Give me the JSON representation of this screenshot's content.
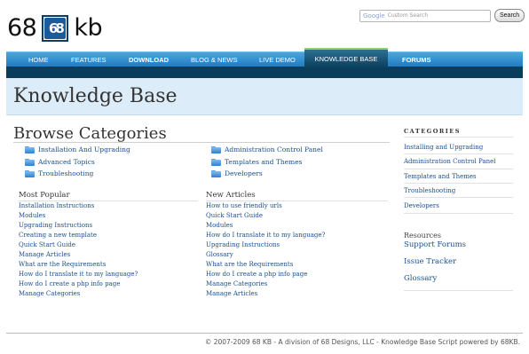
{
  "logo": {
    "left": "68",
    "mark": "68",
    "right": "kb"
  },
  "search": {
    "google": "Google",
    "placeholder": "Custom Search",
    "button": "Search"
  },
  "nav": {
    "items": [
      "HOME",
      "FEATURES",
      "DOWNLOAD",
      "BLOG & NEWS",
      "LIVE DEMO",
      "KNOWLEDGE BASE",
      "FORUMS"
    ],
    "active": "KNOWLEDGE BASE"
  },
  "page_title": "Knowledge Base",
  "browse": {
    "heading": "Browse Categories",
    "categories_left": [
      "Installation And Upgrading",
      "Advanced Topics",
      "Troubleshooting"
    ],
    "categories_right": [
      "Administration Control Panel",
      "Templates and Themes",
      "Developers"
    ]
  },
  "most_popular": {
    "heading": "Most Popular",
    "items": [
      "Installation Instructions",
      "Modules",
      "Upgrading Instructions",
      "Creating a new template",
      "Quick Start Guide",
      "Manage Articles",
      "What are the Requirements",
      "How do I translate it to my language?",
      "How do I create a php info page",
      "Manage Categories"
    ]
  },
  "new_articles": {
    "heading": "New Articles",
    "items": [
      "How to use friendly urls",
      "Quick Start Guide",
      "Modules",
      "How do I translate it to my language?",
      "Upgrading Instructions",
      "Glossary",
      "What are the Requirements",
      "How do I create a php info page",
      "Manage Categories",
      "Manage Articles"
    ]
  },
  "sidebar": {
    "categories_heading": "CATEGORIES",
    "categories": [
      "Installing and Upgrading",
      "Administration Control Panel",
      "Templates and Themes",
      "Troubleshooting",
      "Developers"
    ],
    "resources_heading": "Resources",
    "resources": [
      "Support Forums",
      "Issue Tracker",
      "Glossary"
    ]
  },
  "footer": "© 2007-2009 68 KB - A division of 68 Designs, LLC - Knowledge Base Script powered by 68KB."
}
